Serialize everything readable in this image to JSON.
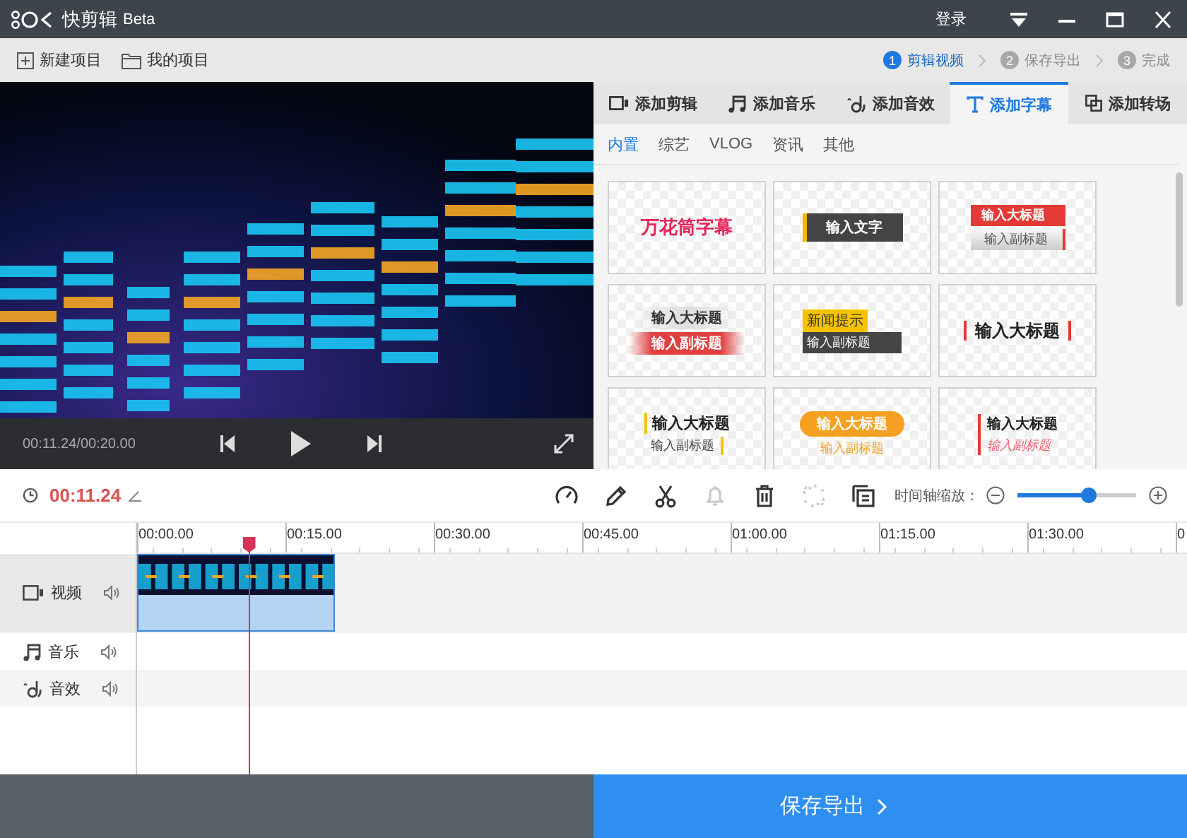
{
  "window": {
    "title": "快剪辑",
    "badge": "Beta",
    "login": "登录"
  },
  "toolbar": {
    "actions": [
      {
        "kind": "new",
        "label": "新建项目"
      },
      {
        "kind": "folder",
        "label": "我的项目"
      }
    ],
    "steps": [
      {
        "number": "1",
        "label": "剪辑视频",
        "selected": true
      },
      {
        "number": "2",
        "label": "保存导出",
        "selected": false
      },
      {
        "number": "3",
        "label": "完成",
        "selected": false
      }
    ]
  },
  "player": {
    "time": "00:11.24/00:20.00"
  },
  "panel": {
    "tabs": [
      {
        "kind": "clip",
        "label": "添加剪辑",
        "selected": false
      },
      {
        "kind": "music",
        "label": "添加音乐",
        "selected": false
      },
      {
        "kind": "sfx",
        "label": "添加音效",
        "selected": false
      },
      {
        "kind": "text",
        "label": "添加字幕",
        "selected": true
      },
      {
        "kind": "transition",
        "label": "添加转场",
        "selected": false
      }
    ],
    "subtabs": [
      {
        "label": "内置",
        "selected": true
      },
      {
        "label": "综艺",
        "selected": false
      },
      {
        "label": "VLOG",
        "selected": false
      },
      {
        "label": "资讯",
        "selected": false
      },
      {
        "label": "其他",
        "selected": false
      }
    ],
    "templates": [
      {
        "kind": "pink",
        "title": "万花筒字幕"
      },
      {
        "kind": "darkbar",
        "title": "输入文字"
      },
      {
        "kind": "redgrey",
        "title": "输入大标题",
        "subtitle": "输入副标题"
      },
      {
        "kind": "blur",
        "title": "输入大标题",
        "subtitle": "输入副标题"
      },
      {
        "kind": "news",
        "title": "新闻提示",
        "subtitle": "输入副标题"
      },
      {
        "kind": "bars",
        "title": "输入大标题"
      },
      {
        "kind": "slash",
        "title": "输入大标题",
        "subtitle": "输入副标题"
      },
      {
        "kind": "pill",
        "title": "输入大标题",
        "subtitle": "输入副标题"
      },
      {
        "kind": "redslash",
        "title": "输入大标题",
        "subtitle": "输入副标题"
      }
    ]
  },
  "editbar": {
    "current_time": "00:11.24",
    "tools": [
      {
        "kind": "speed",
        "disabled": false
      },
      {
        "kind": "pencil",
        "disabled": false
      },
      {
        "kind": "scissors",
        "disabled": false
      },
      {
        "kind": "bell",
        "disabled": true
      },
      {
        "kind": "trash",
        "disabled": false
      },
      {
        "kind": "unlink",
        "disabled": true
      },
      {
        "kind": "copy",
        "disabled": false
      }
    ],
    "zoom_label": "时间轴缩放：",
    "zoom": {
      "level": 0.6
    }
  },
  "timeline": {
    "ticks": [
      "00:00.00",
      "00:15.00",
      "00:30.00",
      "00:45.00",
      "01:00.00",
      "01:15.00",
      "01:30.00",
      "0"
    ],
    "playhead": {
      "level": 0.106
    },
    "tracks": [
      {
        "kind": "video",
        "label": "视频",
        "has_clip": true
      },
      {
        "kind": "music",
        "label": "音乐",
        "has_clip": false
      },
      {
        "kind": "sfx",
        "label": "音效",
        "has_clip": false
      }
    ]
  },
  "footer": {
    "export": "保存导出"
  }
}
